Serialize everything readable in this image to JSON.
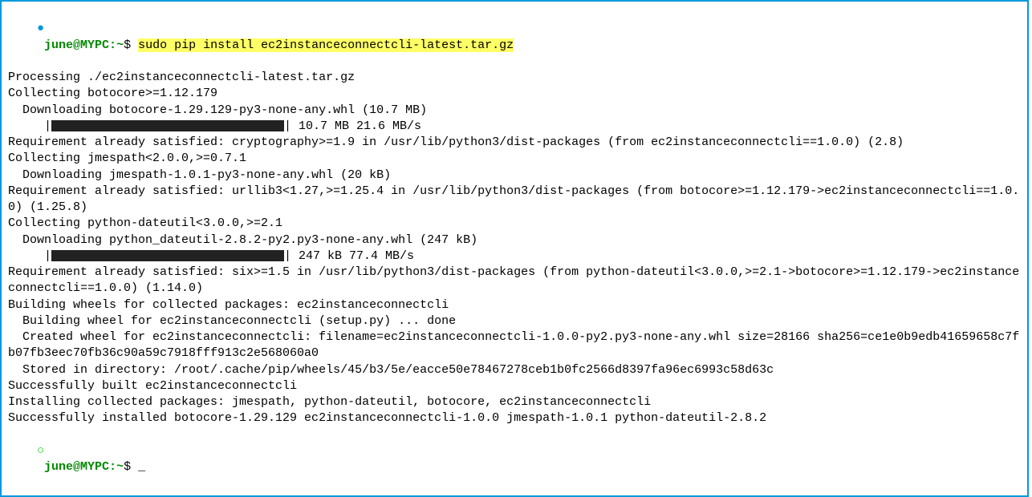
{
  "prompt": {
    "bullet": "●",
    "user_host": "june@MYPC",
    "colon": ":",
    "path": "~",
    "dollar": "$ "
  },
  "command": "sudo pip install ec2instanceconnectcli-latest.tar.gz",
  "output": {
    "l1": "Processing ./ec2instanceconnectcli-latest.tar.gz",
    "l2": "Collecting botocore>=1.12.179",
    "l3": "  Downloading botocore-1.29.129-py3-none-any.whl (10.7 MB)",
    "l4_pre": "     |",
    "l4_post": "| 10.7 MB 21.6 MB/s",
    "l5": "Requirement already satisfied: cryptography>=1.9 in /usr/lib/python3/dist-packages (from ec2instanceconnectcli==1.0.0) (2.8)",
    "l6": "Collecting jmespath<2.0.0,>=0.7.1",
    "l7": "  Downloading jmespath-1.0.1-py3-none-any.whl (20 kB)",
    "l8": "Requirement already satisfied: urllib3<1.27,>=1.25.4 in /usr/lib/python3/dist-packages (from botocore>=1.12.179->ec2instanceconnectcli==1.0.0) (1.25.8)",
    "l9": "Collecting python-dateutil<3.0.0,>=2.1",
    "l10": "  Downloading python_dateutil-2.8.2-py2.py3-none-any.whl (247 kB)",
    "l11_pre": "     |",
    "l11_post": "| 247 kB 77.4 MB/s",
    "l12": "Requirement already satisfied: six>=1.5 in /usr/lib/python3/dist-packages (from python-dateutil<3.0.0,>=2.1->botocore>=1.12.179->ec2instanceconnectcli==1.0.0) (1.14.0)",
    "l13": "Building wheels for collected packages: ec2instanceconnectcli",
    "l14": "  Building wheel for ec2instanceconnectcli (setup.py) ... done",
    "l15": "  Created wheel for ec2instanceconnectcli: filename=ec2instanceconnectcli-1.0.0-py2.py3-none-any.whl size=28166 sha256=ce1e0b9edb41659658c7fb07fb3eec70fb36c90a59c7918fff913c2e568060a0",
    "l16": "  Stored in directory: /root/.cache/pip/wheels/45/b3/5e/eacce50e78467278ceb1b0fc2566d8397fa96ec6993c58d63c",
    "l17": "Successfully built ec2instanceconnectcli",
    "l18": "Installing collected packages: jmespath, python-dateutil, botocore, ec2instanceconnectcli",
    "l19": "Successfully installed botocore-1.29.129 ec2instanceconnectcli-1.0.0 jmespath-1.0.1 python-dateutil-2.8.2"
  },
  "cursor": "_"
}
